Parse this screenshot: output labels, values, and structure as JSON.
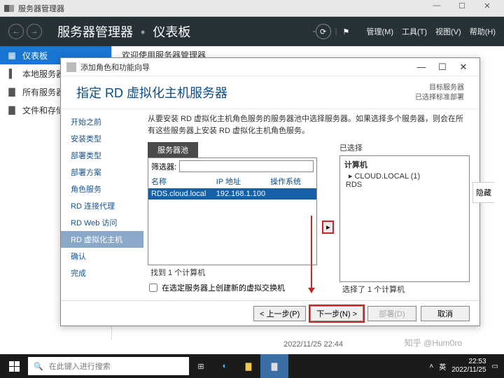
{
  "app": {
    "title": "服务器管理器"
  },
  "sysbtns": {
    "min": "—",
    "max": "☐",
    "close": "✕"
  },
  "header": {
    "crumb_root": "服务器管理器",
    "crumb_current": "仪表板",
    "menu": {
      "manage": "管理(M)",
      "tools": "工具(T)",
      "view": "视图(V)",
      "help": "帮助(H)"
    }
  },
  "sidebar": {
    "items": [
      {
        "icon": "▦",
        "label": "仪表板"
      },
      {
        "icon": "▌",
        "label": "本地服务器"
      },
      {
        "icon": "▇",
        "label": "所有服务器"
      },
      {
        "icon": "▇",
        "label": "文件和存储…"
      }
    ]
  },
  "welcome": "欢迎使用服务器管理器",
  "wizard": {
    "title": "添加角色和功能向导",
    "heading": "指定 RD 虚拟化主机服务器",
    "meta1": "目标服务器",
    "meta2": "已选择标准部署",
    "steps": [
      "开始之前",
      "安装类型",
      "部署类型",
      "部署方案",
      "角色服务",
      "RD 连接代理",
      "RD Web 访问",
      "RD 虚拟化主机",
      "确认",
      "完成"
    ],
    "current_step": 7,
    "desc": "从要安装 RD 虚拟化主机角色服务的服务器池中选择服务器。如果选择多个服务器，则会在所有这些服务器上安装 RD 虚拟化主机角色服务。",
    "pool_tab": "服务器池",
    "filter_label": "筛选器:",
    "filter_value": "",
    "cols": {
      "name": "名称",
      "ip": "IP 地址",
      "os": "操作系统"
    },
    "row": {
      "name": "RDS.cloud.local",
      "ip": "192.168.1.100",
      "os": ""
    },
    "found": "找到 1 个计算机",
    "checkbox": "在选定服务器上创建新的虚拟交换机",
    "selected_label": "已选择",
    "selected_header": "计算机",
    "selected_group": "▸ CLOUD.LOCAL (1)",
    "selected_item": "RDS",
    "selected_count": "选择了 1 个计算机",
    "hide": "隐藏",
    "buttons": {
      "prev": "< 上一步(P)",
      "next": "下一步(N) >",
      "deploy": "部署(D)",
      "cancel": "取消"
    }
  },
  "timestamp_below": "2022/11/25 22:44",
  "watermark": "知乎 @Hum0ro",
  "taskbar": {
    "search_placeholder": "在此键入进行搜索",
    "time": "22:53",
    "date": "2022/11/25"
  }
}
